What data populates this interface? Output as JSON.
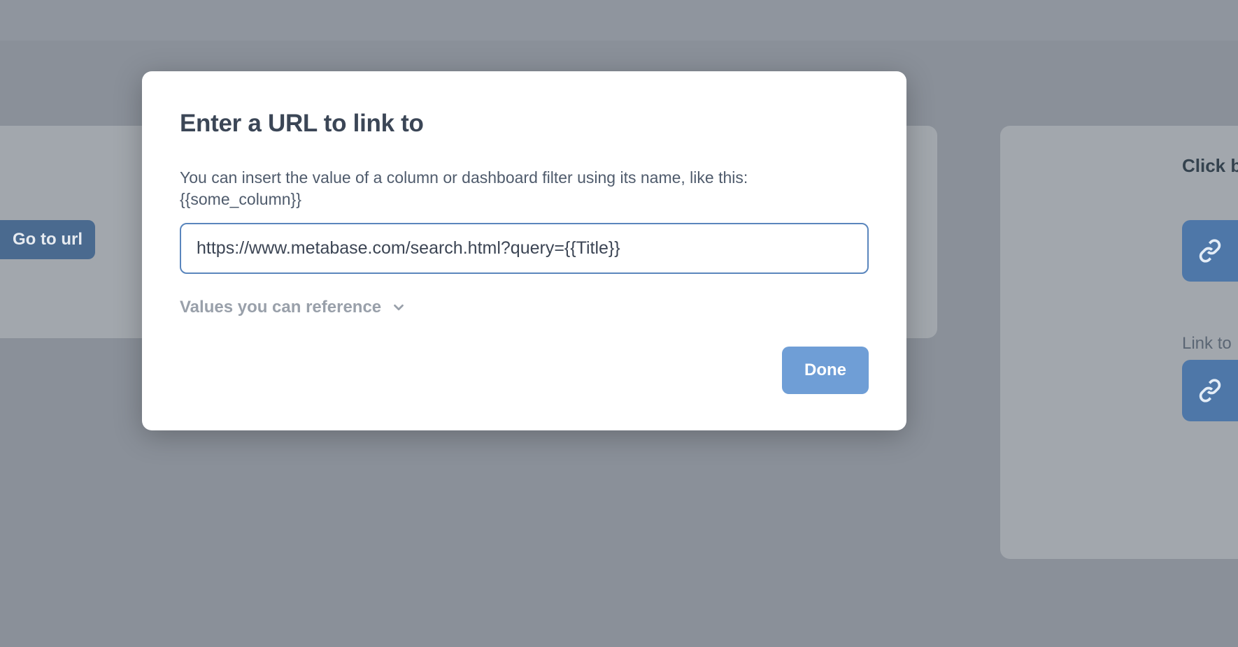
{
  "background": {
    "go_to_url_label": "Go to url",
    "sidebar_label_1": "Click b",
    "sidebar_label_2": "Link to"
  },
  "modal": {
    "title": "Enter a URL to link to",
    "description": "You can insert the value of a column or dashboard filter using its name, like this: {{some_column}}",
    "url_value": "https://www.metabase.com/search.html?query={{Title}}",
    "values_reference_label": "Values you can reference",
    "done_label": "Done"
  }
}
